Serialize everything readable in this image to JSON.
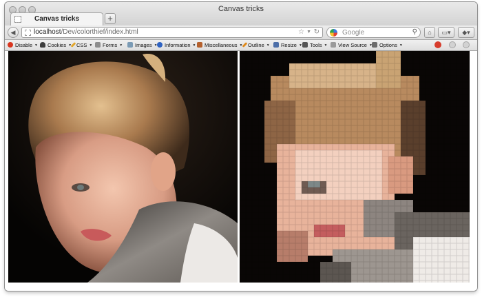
{
  "window": {
    "title": "Canvas tricks"
  },
  "tabs": [
    {
      "label": "Canvas tricks"
    }
  ],
  "new_tab_symbol": "+",
  "nav": {
    "url_host": "localhost",
    "url_path": "/Dev/colorthief/index.html",
    "search_placeholder": "Google"
  },
  "devtoolbar": {
    "items": [
      {
        "label": "Disable",
        "icon": "disable-icon",
        "color": "#d9361f"
      },
      {
        "label": "Cookies",
        "icon": "user-icon",
        "color": "#3c3c3c"
      },
      {
        "label": "CSS",
        "icon": "pencil-icon",
        "color": "#e3a62a"
      },
      {
        "label": "Forms",
        "icon": "form-icon",
        "color": "#8d8d8d"
      },
      {
        "label": "Images",
        "icon": "image-icon",
        "color": "#7b9bb5"
      },
      {
        "label": "Information",
        "icon": "info-icon",
        "color": "#2f63c2"
      },
      {
        "label": "Miscellaneous",
        "icon": "toolbox-icon",
        "color": "#b5612d"
      },
      {
        "label": "Outline",
        "icon": "outline-pencil-icon",
        "color": "#e08a1d"
      },
      {
        "label": "Resize",
        "icon": "resize-icon",
        "color": "#4d6fa8"
      },
      {
        "label": "Tools",
        "icon": "tools-icon",
        "color": "#555555"
      },
      {
        "label": "View Source",
        "icon": "source-icon",
        "color": "#9a9a9a"
      },
      {
        "label": "Options",
        "icon": "options-icon",
        "color": "#6c6c6c"
      }
    ]
  },
  "colors": {
    "close_button": "#d73c2c",
    "photo_background": "#090706"
  }
}
